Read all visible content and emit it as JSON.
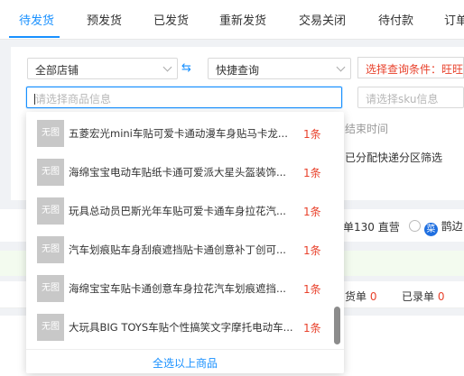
{
  "tabs": [
    {
      "label": "待发货",
      "active": true
    },
    {
      "label": "预发货",
      "active": false
    },
    {
      "label": "已发货",
      "active": false
    },
    {
      "label": "重新发货",
      "active": false
    },
    {
      "label": "交易关闭",
      "active": false
    },
    {
      "label": "待付款",
      "active": false
    },
    {
      "label": "订单",
      "active": false
    }
  ],
  "filters": {
    "store_select": "全部店铺",
    "swap_icon": "⇆",
    "query_select": "快捷查询",
    "warning_text": "选择查询条件：旺旺",
    "product_input_placeholder": "请选择商品信息",
    "sku_input_placeholder": "请选择sku信息",
    "end_time_placeholder": "结束时间",
    "express_filter": "已分配快递分区筛选"
  },
  "background": {
    "count_text": "单130 直营",
    "cai_badge": "菜",
    "cai_label": "鹊边",
    "cell_label_1": "货单",
    "cell_value_1": "0",
    "cell_label_2": "已录单",
    "cell_value_2": "0"
  },
  "dropdown": {
    "thumb_label": "无图",
    "items": [
      {
        "title": "五菱宏光mini车贴可爱卡通动漫车身贴马卡龙...",
        "count": "1条"
      },
      {
        "title": "海绵宝宝电动车贴纸卡通可爱派大星头盔装饰...",
        "count": "1条"
      },
      {
        "title": "玩具总动员巴斯光年车贴可爱卡通车身拉花汽...",
        "count": "1条"
      },
      {
        "title": "汽车划痕贴车身刮痕遮挡贴卡通创意补丁创可...",
        "count": "1条"
      },
      {
        "title": "海绵宝宝车贴卡通创意车身拉花汽车划痕遮挡...",
        "count": "1条"
      },
      {
        "title": "大玩具BIG TOYS车贴个性搞笑文字摩托电动车...",
        "count": "1条"
      }
    ],
    "footer_label": "全选以上商品"
  },
  "colors": {
    "accent": "#1890ff",
    "warning": "#e8412b"
  }
}
